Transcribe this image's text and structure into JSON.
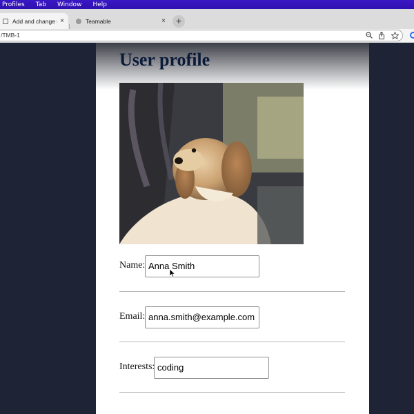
{
  "menubar": {
    "items": [
      "Profiles",
      "Tab",
      "Window",
      "Help"
    ]
  },
  "tabs": [
    {
      "title": "Add and change user",
      "close": "×"
    },
    {
      "title": "Teamable",
      "close": "×"
    }
  ],
  "newtab_label": "+",
  "address_bar": {
    "url": "/TMB-1"
  },
  "toolbar_icons": [
    "zoom-icon",
    "share-icon",
    "bookmark-star-icon",
    "extension-icon"
  ],
  "profile": {
    "title": "User profile",
    "photo_icon": "dog-photo",
    "fields": {
      "name": {
        "label": "Name:",
        "value": "Anna Smith"
      },
      "email": {
        "label": "Email:",
        "value": "anna.smith@example.com"
      },
      "interests": {
        "label": "Interests:",
        "value": "coding"
      }
    }
  },
  "colors": {
    "menubar": "#2f10b0",
    "page_bg": "#1e2436",
    "title": "#0c1a3a"
  }
}
